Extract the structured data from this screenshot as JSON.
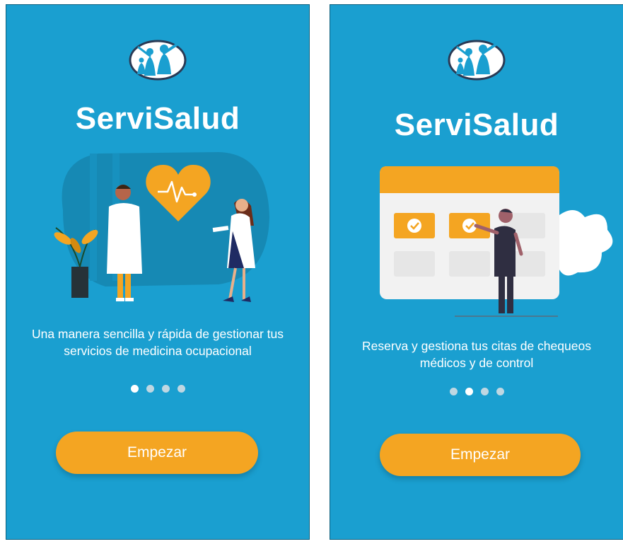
{
  "screens": [
    {
      "brand": "ServiSalud",
      "tagline": "Una manera sencilla y rápida de gestionar tus servicios de medicina ocupacional",
      "button": "Empezar",
      "illustration": "doctors-heart-illustration",
      "pagination": {
        "total": 4,
        "active": 1
      }
    },
    {
      "brand": "ServiSalud",
      "tagline": "Reserva y gestiona tus citas de chequeos médicos y de control",
      "button": "Empezar",
      "illustration": "calendar-booking-illustration",
      "pagination": {
        "total": 4,
        "active": 2
      }
    }
  ],
  "colors": {
    "background": "#1a9fd0",
    "accent": "#f4a522",
    "text": "#ffffff",
    "dot_inactive": "#bfd7e2",
    "dot_active": "#ffffff"
  },
  "icons": [
    "family-logo-icon",
    "heartbeat-heart-icon",
    "checkmark-icon"
  ]
}
